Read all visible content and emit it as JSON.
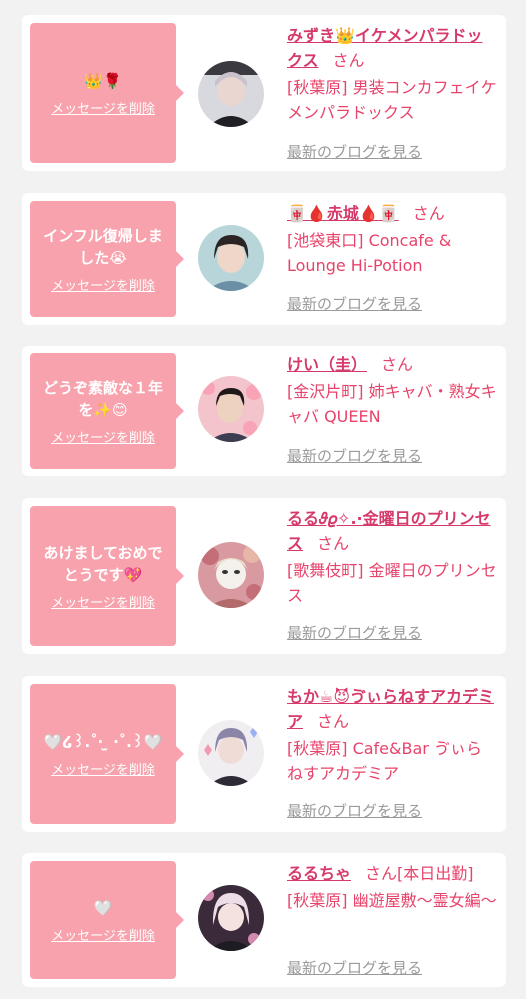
{
  "common": {
    "delete_label": "メッセージを削除",
    "san_label": "さん",
    "blog_label": "最新のブログを見る"
  },
  "colors": {
    "bubble": "#f7a2ad",
    "name": "#d63a6a",
    "text": "#e8436a",
    "link_gray": "#9a9a9a"
  },
  "cards": [
    {
      "message": "👑🌹",
      "name": "みずき👑イケメンパラドックス",
      "suffix": "",
      "shop": "[秋葉原] 男装コンカフェイケメンパラドックス",
      "avatar_icon": "avatar-photo-icon"
    },
    {
      "message": "インフル復帰しました😭",
      "name": "🀄🩸赤城🩸🀄",
      "suffix": "",
      "shop": "[池袋東口] Concafe & Lounge Hi-Potion",
      "avatar_icon": "avatar-photo-icon"
    },
    {
      "message": "どうぞ素敵な１年を✨😊",
      "name": "けい（圭）",
      "suffix": "",
      "shop": "[金沢片町] 姉キャバ・熟女キャバ QUEEN",
      "avatar_icon": "avatar-photo-icon"
    },
    {
      "message": "あけましておめでとうです💖",
      "name": "るる𝜗𝜚✧.·金曜日のプリンセス",
      "suffix": "",
      "shop": "[歌舞伎町] 金曜日のプリンセス",
      "avatar_icon": "avatar-photo-icon"
    },
    {
      "message": "🤍໒꒱.˚‧ ̫ ‧˚.꒱🤍",
      "name": "もか☕😈ゔぃらねすアカデミア",
      "suffix": "",
      "shop": "[秋葉原] Cafe&Bar ゔぃらねすアカデミア",
      "avatar_icon": "avatar-photo-icon"
    },
    {
      "message": "🤍",
      "name": "るるちゃ",
      "suffix": "[本日出勤]",
      "shop": "[秋葉原] 幽遊屋敷〜霊女編〜",
      "avatar_icon": "avatar-photo-icon"
    }
  ]
}
